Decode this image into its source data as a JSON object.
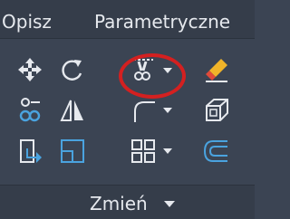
{
  "tabs": [
    {
      "label": "Opisz"
    },
    {
      "label": "Parametryczne"
    }
  ],
  "panel": {
    "title": "Zmień",
    "tools": [
      {
        "icon": "move-icon"
      },
      {
        "icon": "rotate-icon"
      },
      {
        "icon": "trim-icon",
        "has_dropdown": true,
        "highlighted": true
      },
      {
        "icon": "erase-icon"
      },
      {
        "icon": "copy-icon"
      },
      {
        "icon": "mirror-icon"
      },
      {
        "icon": "fillet-icon",
        "has_dropdown": true
      },
      {
        "icon": "3d-box-icon"
      },
      {
        "icon": "stretch-icon"
      },
      {
        "icon": "scale-icon"
      },
      {
        "icon": "array-icon",
        "has_dropdown": true
      },
      {
        "icon": "offset-icon"
      }
    ]
  },
  "colors": {
    "background": "#3b4453",
    "icon": "#e6e9ee",
    "accent_blue": "#4aa3df",
    "highlight_red": "#d42020",
    "erase_yellow": "#f0b429",
    "erase_red": "#e04a3a"
  }
}
